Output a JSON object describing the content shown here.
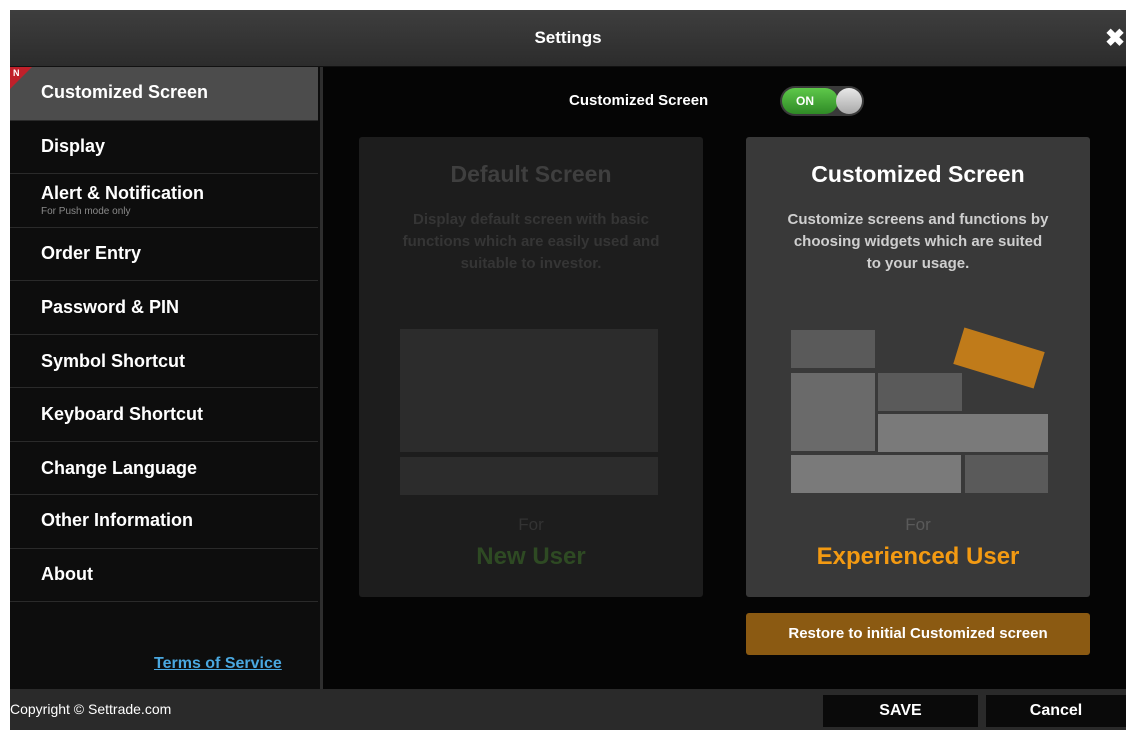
{
  "window": {
    "title": "Settings",
    "close_icon": "close-icon"
  },
  "sidebar": {
    "items": [
      {
        "label": "Customized Screen",
        "sub": "",
        "active": true,
        "badge": "N"
      },
      {
        "label": "Display",
        "sub": ""
      },
      {
        "label": "Alert & Notification",
        "sub": "For Push mode only"
      },
      {
        "label": "Order Entry",
        "sub": ""
      },
      {
        "label": "Password & PIN",
        "sub": ""
      },
      {
        "label": "Symbol Shortcut",
        "sub": ""
      },
      {
        "label": "Keyboard Shortcut",
        "sub": ""
      },
      {
        "label": "Change Language",
        "sub": ""
      },
      {
        "label": "Other Information",
        "sub": ""
      },
      {
        "label": "About",
        "sub": ""
      }
    ],
    "terms_link": "Terms of Service"
  },
  "main": {
    "toggle": {
      "label": "Customized Screen",
      "state": "ON"
    },
    "cards": {
      "default": {
        "title": "Default Screen",
        "description": "Display default screen with basic functions which are easily used and suitable to investor.",
        "for_label": "For",
        "user_label": "New User"
      },
      "custom": {
        "title": "Customized Screen",
        "description": "Customize screens and functions by choosing widgets which are suited to your usage.",
        "for_label": "For",
        "user_label": "Experienced User"
      }
    },
    "restore_button": "Restore to initial Customized screen"
  },
  "footer": {
    "copyright": "Copyright © Settrade.com",
    "save_button": "SAVE",
    "cancel_button": "Cancel"
  },
  "colors": {
    "accent_orange": "#f39a12",
    "restore_button": "#8b5a12",
    "toggle_on": "#3ea834",
    "link": "#4aa8e0",
    "badge": "#c0202a"
  }
}
